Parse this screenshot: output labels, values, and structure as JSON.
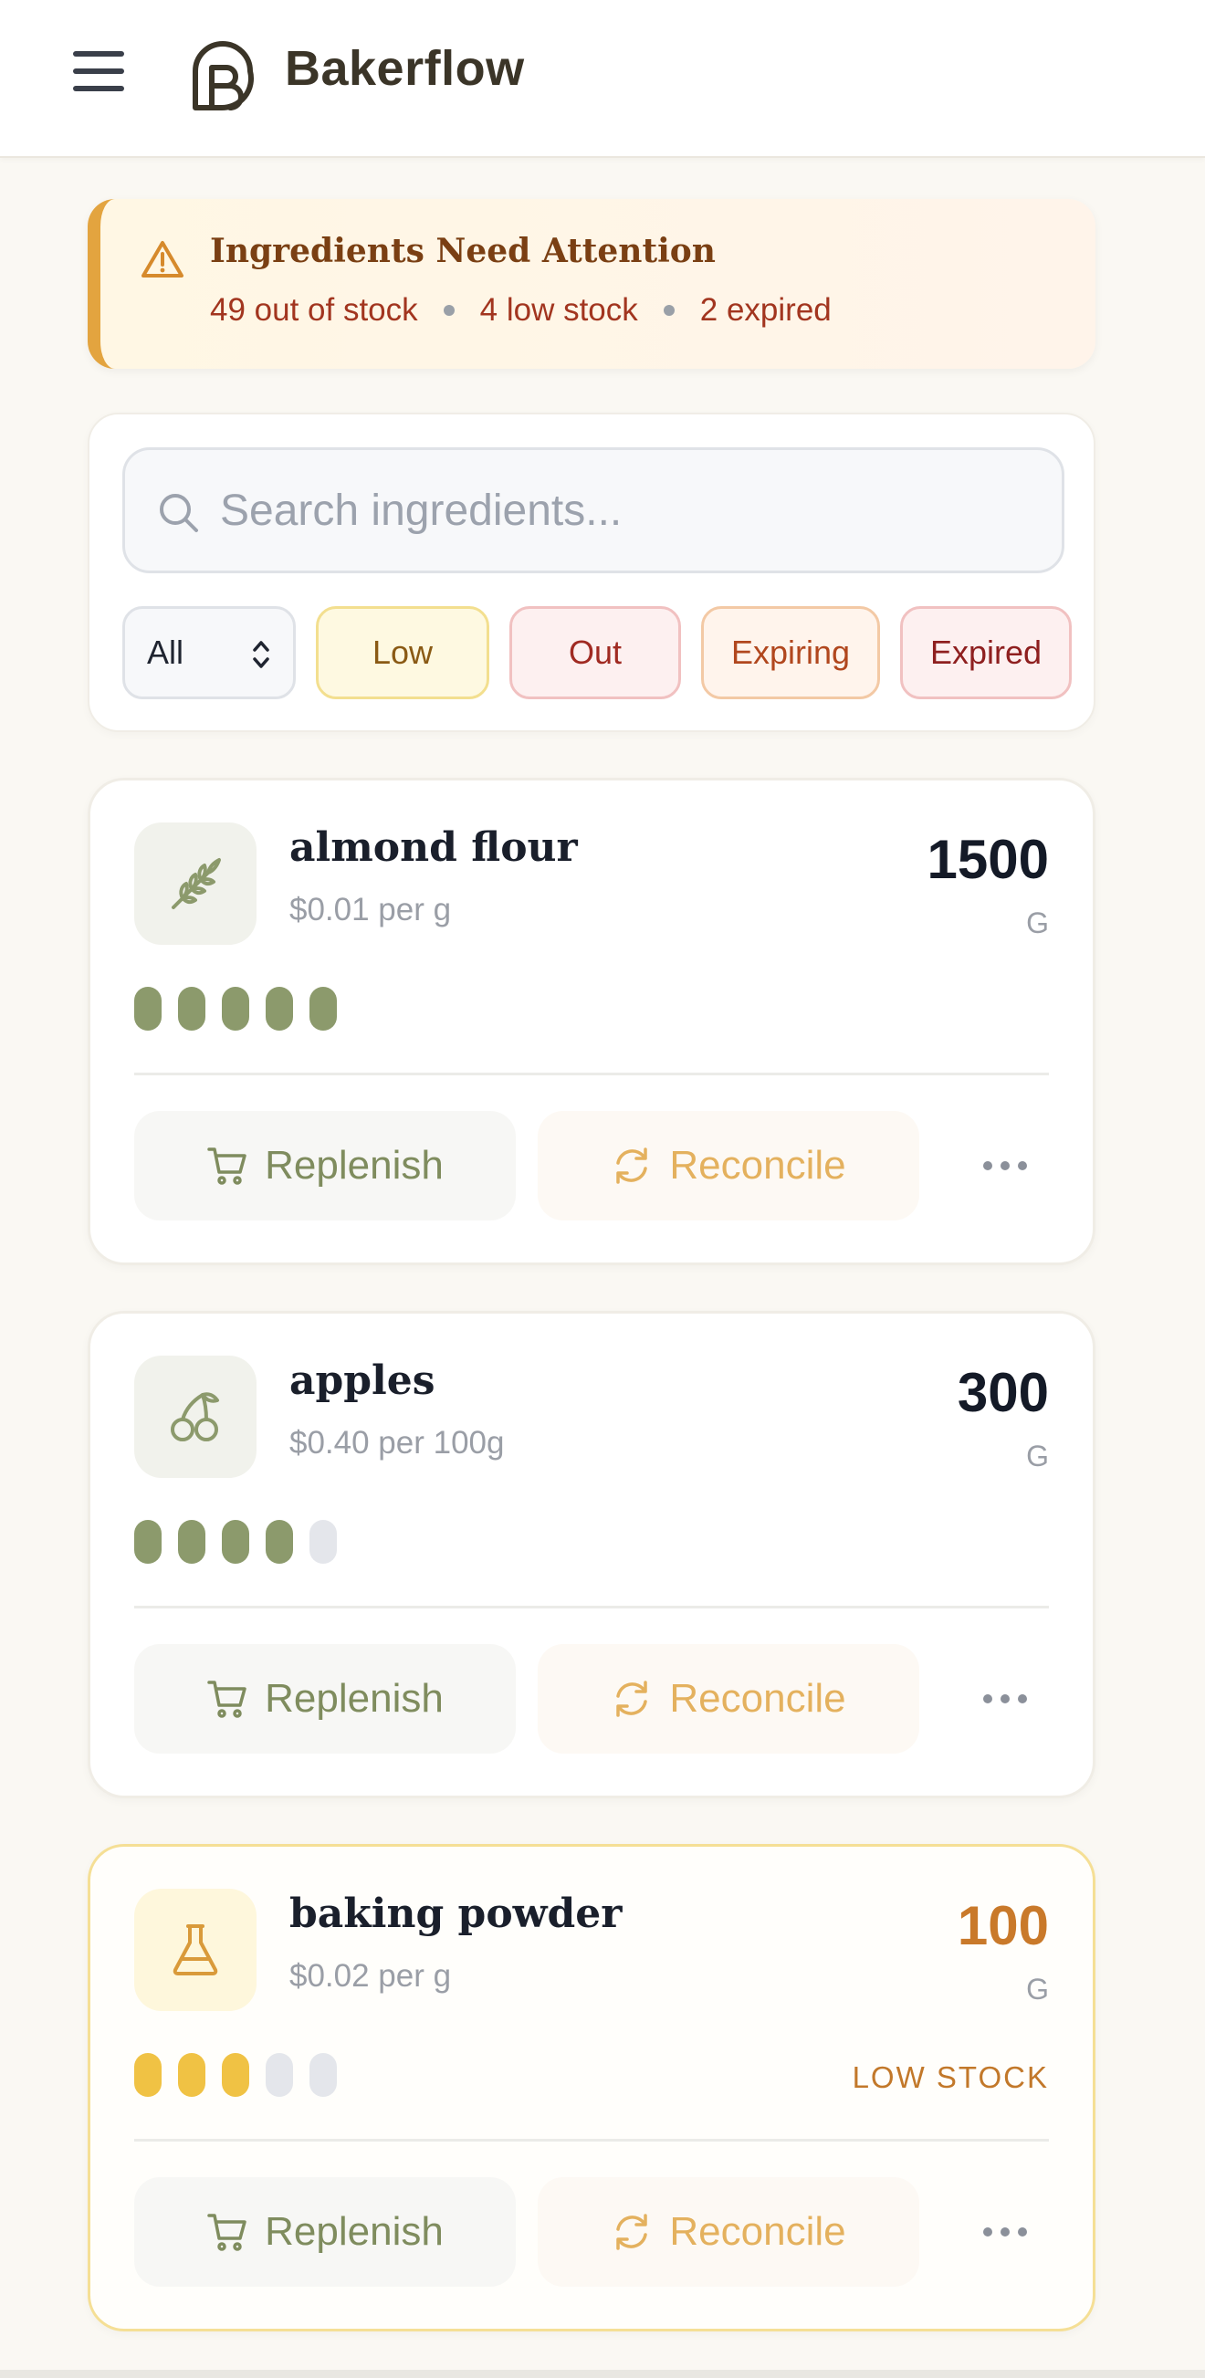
{
  "app": {
    "brand": "Bakerflow"
  },
  "alert": {
    "title": "Ingredients Need Attention",
    "out_of_stock": "49 out of stock",
    "low_stock": "4 low stock",
    "expired": "2 expired",
    "accent_color": "#e3a43f"
  },
  "search": {
    "placeholder": "Search ingredients...",
    "value": ""
  },
  "filters": {
    "select_value": "All",
    "chips": [
      "Low",
      "Out",
      "Expiring",
      "Expired"
    ]
  },
  "ingredients": [
    {
      "name": "almond flour",
      "price": "$0.01 per g",
      "quantity": "1500",
      "unit": "G",
      "level": 5,
      "level_max": 5,
      "icon": "wheat-icon",
      "status": "",
      "replenish": "Replenish",
      "reconcile": "Reconcile"
    },
    {
      "name": "apples",
      "price": "$0.40 per 100g",
      "quantity": "300",
      "unit": "G",
      "level": 4,
      "level_max": 5,
      "icon": "cherry-icon",
      "status": "",
      "replenish": "Replenish",
      "reconcile": "Reconcile"
    },
    {
      "name": "baking powder",
      "price": "$0.02 per g",
      "quantity": "100",
      "unit": "G",
      "level": 3,
      "level_max": 5,
      "icon": "flask-icon",
      "status": "LOW STOCK",
      "replenish": "Replenish",
      "reconcile": "Reconcile"
    }
  ],
  "colors": {
    "stock_ok": "#8c9a6c",
    "stock_low": "#f0c244",
    "low_text": "#c9792a",
    "alert_text": "#a2351f"
  }
}
